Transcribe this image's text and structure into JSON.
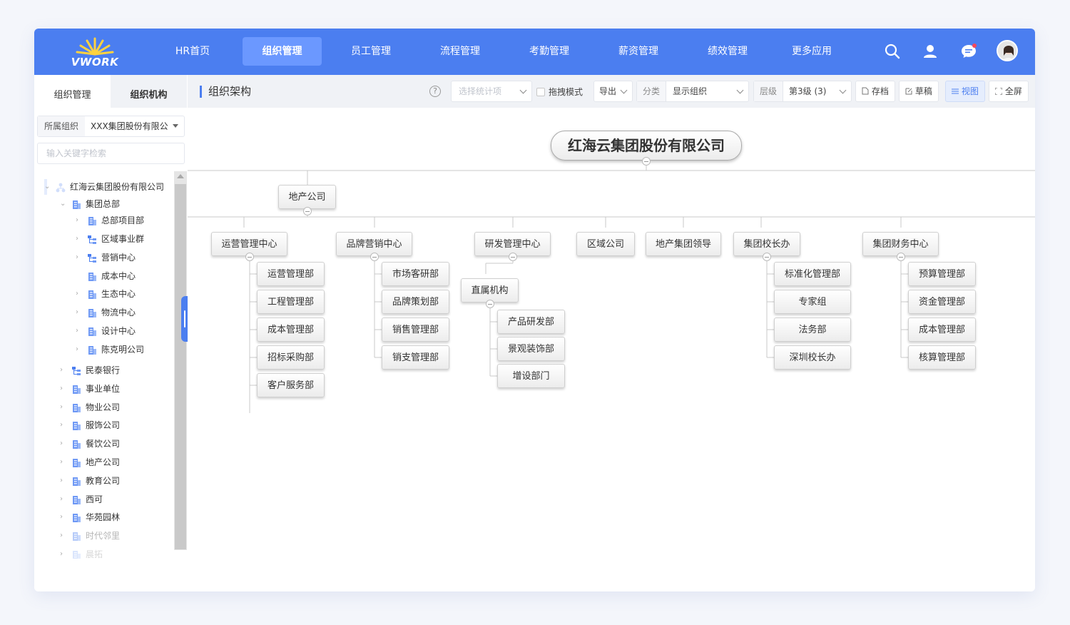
{
  "app": {
    "logo_text": "VWORK",
    "nav": [
      {
        "label": "HR首页"
      },
      {
        "label": "组织管理"
      },
      {
        "label": "员工管理"
      },
      {
        "label": "流程管理"
      },
      {
        "label": "考勤管理"
      },
      {
        "label": "薪资管理"
      },
      {
        "label": "绩效管理"
      },
      {
        "label": "更多应用"
      }
    ],
    "active_nav": "组织管理",
    "accent_color": "#4b7ef0"
  },
  "sidebar": {
    "tabs": [
      {
        "label": "组织管理"
      },
      {
        "label": "组织机构"
      }
    ],
    "org_select_label": "所属组织",
    "org_select_value": "XXX集团股份有限公",
    "search_placeholder": "输入关键字检索",
    "tree": [
      {
        "label": "红海云集团股份有限公司",
        "icon": "org-structure-icon"
      },
      {
        "label": "集团总部",
        "icon": "building-icon"
      },
      {
        "label": "总部项目部",
        "icon": "building-icon"
      },
      {
        "label": "区域事业群",
        "icon": "hierarchy-icon"
      },
      {
        "label": "营销中心",
        "icon": "hierarchy-icon"
      },
      {
        "label": "成本中心",
        "icon": "building-icon"
      },
      {
        "label": "生态中心",
        "icon": "building-icon"
      },
      {
        "label": "物流中心",
        "icon": "building-icon"
      },
      {
        "label": "设计中心",
        "icon": "building-icon"
      },
      {
        "label": "陈克明公司",
        "icon": "building-icon"
      },
      {
        "label": "民泰银行",
        "icon": "hierarchy-icon"
      },
      {
        "label": "事业单位",
        "icon": "building-icon"
      },
      {
        "label": "物业公司",
        "icon": "building-icon"
      },
      {
        "label": "服饰公司",
        "icon": "building-icon"
      },
      {
        "label": "餐饮公司",
        "icon": "building-icon"
      },
      {
        "label": "地产公司",
        "icon": "building-icon"
      },
      {
        "label": "教育公司",
        "icon": "building-icon"
      },
      {
        "label": "西可",
        "icon": "building-icon"
      },
      {
        "label": "华苑园林",
        "icon": "building-icon"
      },
      {
        "label": "时代邻里",
        "icon": "building-icon"
      },
      {
        "label": "晨拓",
        "icon": "building-icon"
      }
    ]
  },
  "main": {
    "title": "组织架构",
    "toolbar": {
      "stat_placeholder": "选择统计项",
      "drag_mode": "拖拽模式",
      "export": "导出",
      "category_label": "分类",
      "category_value": "显示组织",
      "level_label": "层级",
      "level_value": "第3级 (3)",
      "archive": "存档",
      "draft": "草稿",
      "view": "视图",
      "fullscreen": "全屏"
    },
    "org_chart": {
      "root": "红海云集团股份有限公司",
      "level1": "地产公司",
      "level2": [
        {
          "label": "运营管理中心",
          "children": [
            "运营管理部",
            "工程管理部",
            "成本管理部",
            "招标采购部",
            "客户服务部"
          ]
        },
        {
          "label": "品牌营销中心",
          "children": [
            "市场客研部",
            "品牌策划部",
            "销售管理部",
            "销支管理部"
          ]
        },
        {
          "label": "研发管理中心",
          "children": [
            "直属机构"
          ],
          "grandchildren": [
            "产品研发部",
            "景观装饰部",
            "增设部门"
          ]
        },
        {
          "label": "区域公司",
          "children": []
        },
        {
          "label": "地产集团领导",
          "children": []
        },
        {
          "label": "集团校长办",
          "children": [
            "标准化管理部",
            "专家组",
            "法务部",
            "深圳校长办"
          ]
        },
        {
          "label": "集团财务中心",
          "children": [
            "预算管理部",
            "资金管理部",
            "成本管理部",
            "核算管理部"
          ]
        }
      ]
    }
  }
}
